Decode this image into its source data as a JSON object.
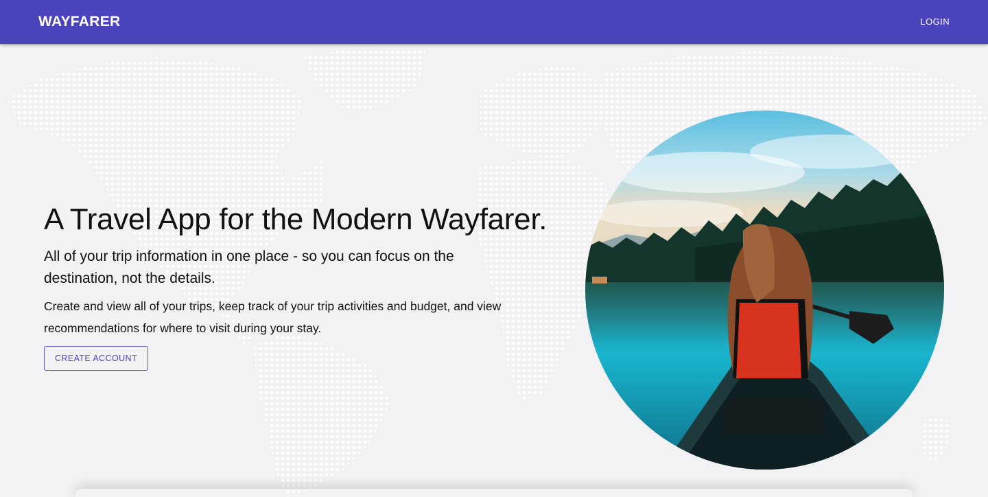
{
  "header": {
    "brand": "WAYFARER",
    "login_label": "LOGIN"
  },
  "hero": {
    "title": "A Travel App for the Modern Wayfarer.",
    "subtitle": "All of your trip information in one place - so you can focus on the destination, not the details.",
    "body": "Create and view all of your trips, keep track of your trip activities and budget, and view recommendations for where to visit during your stay.",
    "cta_label": "CREATE ACCOUNT"
  },
  "icons": {
    "background": "world-map-dots",
    "photo": "canoe-lake-photo"
  },
  "colors": {
    "primary": "#4c44bd",
    "background": "#f2f1f4",
    "text": "#111111"
  }
}
